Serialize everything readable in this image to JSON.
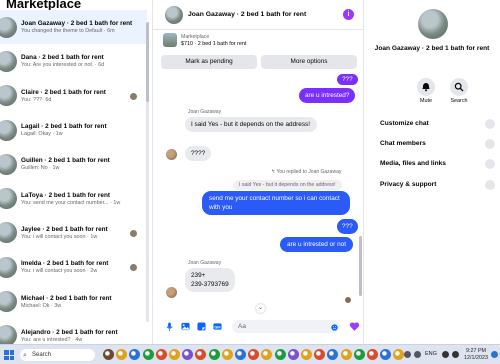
{
  "left_panel": {
    "heading": "Marketplace",
    "chats": [
      {
        "name": "Joan Gazaway · 2 bed 1 bath for rent",
        "snippet": "You changed the theme to Default · 6m",
        "active": true,
        "mini": false
      },
      {
        "name": "Dana · 2 bed 1 bath for rent",
        "snippet": "You: Are you interested or not. · 6d",
        "active": false,
        "mini": false
      },
      {
        "name": "Claire · 2 bed 1 bath for rent",
        "snippet": "You: ???· 6d",
        "active": false,
        "mini": true
      },
      {
        "name": "Lagail · 2 bed 1 bath for rent",
        "snippet": "Lagail: Okay · 1w",
        "active": false,
        "mini": false
      },
      {
        "name": "Guillen · 2 bed 1 bath for rent",
        "snippet": "Guillen: No · 1w",
        "active": false,
        "mini": false
      },
      {
        "name": "LaToya · 2 bed 1 bath for rent",
        "snippet": "You: send me your contact number... · 1w",
        "active": false,
        "mini": false
      },
      {
        "name": "Jaylee · 2 bed 1 bath for rent",
        "snippet": "You: i will contact you soon · 1w",
        "active": false,
        "mini": true
      },
      {
        "name": "Imelda · 2 bed 1 bath for rent",
        "snippet": "You: i will contact you soon · 2w",
        "active": false,
        "mini": true
      },
      {
        "name": "Michael · 2 bed 1 bath for rent",
        "snippet": "Michael: Ok · 3w",
        "active": false,
        "mini": false
      },
      {
        "name": "Alejandro · 2 bed 1 bath for rent",
        "snippet": "You: are u intrested? · 4w",
        "active": false,
        "mini": false
      }
    ]
  },
  "conversation": {
    "title": "Joan Gazaway · 2 bed 1 bath for rent",
    "listing_label": "Marketplace",
    "listing_detail": "$710 · 2 bed 1 bath for rent",
    "mark_pending_label": "Mark as pending",
    "more_options_label": "More options",
    "sender_name": "Joan Gazaway",
    "sender_name_2": "Joan Gazaway",
    "msg_q1": "???",
    "msg_are_u": "are u intrested?",
    "msg_yes": "I said Yes - but it depends on the address!",
    "msg_q2": "????",
    "replied_label": "You replied to Joan Gazaway",
    "quoted_text": "I said Yes - but it depends on the address!",
    "msg_send_number": "send me your contact number so i can contact with you",
    "msg_q3": "???",
    "msg_are_u_or_not": "are u intrested or not",
    "msg_phone": "239+\n239-3793769",
    "composer_placeholder": "Aa"
  },
  "right_panel": {
    "name": "Joan Gazaway · 2 bed 1 bath for rent",
    "mute_label": "Mute",
    "search_label": "Search",
    "sections": [
      "Customize chat",
      "Chat members",
      "Media, files and links",
      "Privacy & support"
    ]
  },
  "taskbar": {
    "search_placeholder": "Search",
    "lang": "ENG",
    "time": "9:27 PM",
    "date": "12/1/2023"
  },
  "colors": {
    "accent_purple": "#7b2fff",
    "bubble_blue": "#2a5af7",
    "incoming_bubble": "#e9eaed"
  }
}
